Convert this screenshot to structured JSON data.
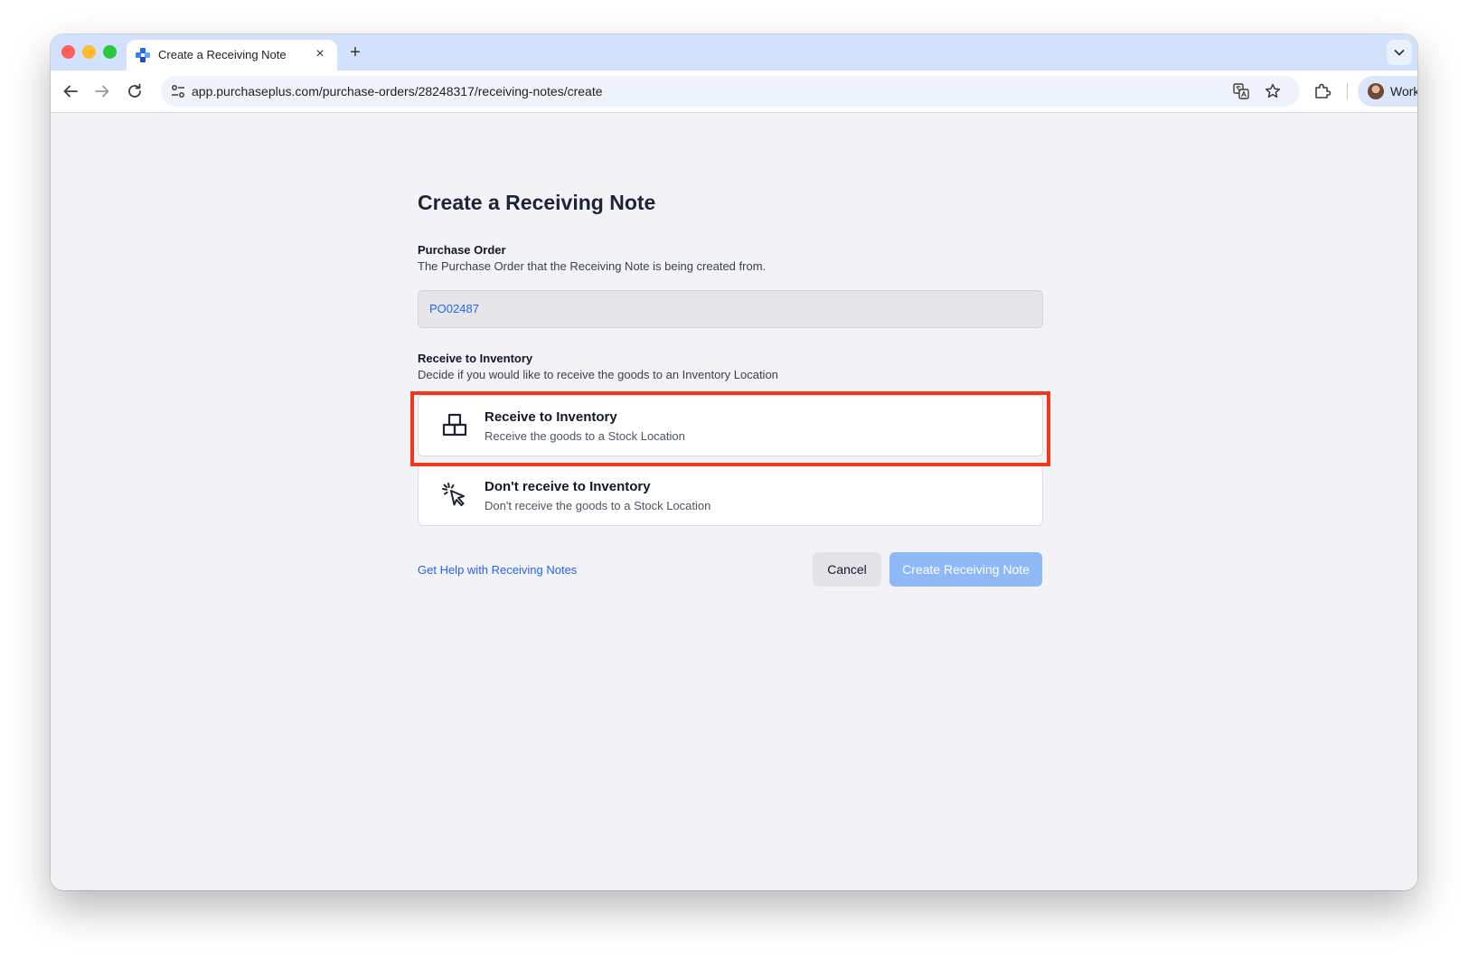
{
  "browser": {
    "tab": {
      "title": "Create a Receiving Note",
      "close": "×",
      "new_tab": "+"
    },
    "url": "app.purchaseplus.com/purchase-orders/28248317/receiving-notes/create",
    "profile_label": "Work"
  },
  "page": {
    "title": "Create a Receiving Note",
    "purchase_order": {
      "label": "Purchase Order",
      "description": "The Purchase Order that the Receiving Note is being created from.",
      "value": "PO02487"
    },
    "inventory": {
      "label": "Receive to Inventory",
      "description": "Decide if you would like to receive the goods to an Inventory Location",
      "options": [
        {
          "title": "Receive to Inventory",
          "description": "Receive the goods to a Stock Location",
          "icon": "boxes-icon",
          "highlighted": true
        },
        {
          "title": "Don't receive to Inventory",
          "description": "Don't receive the goods to a Stock Location",
          "icon": "cursor-click-icon",
          "highlighted": false
        }
      ]
    },
    "help_link": "Get Help with Receiving Notes",
    "buttons": {
      "cancel": "Cancel",
      "create": "Create Receiving Note"
    }
  },
  "colors": {
    "accent": "#2563eb",
    "create_button": "#8fb8f6",
    "highlight_border": "#ee3a1a",
    "tabstrip": "#d3e2fc"
  }
}
